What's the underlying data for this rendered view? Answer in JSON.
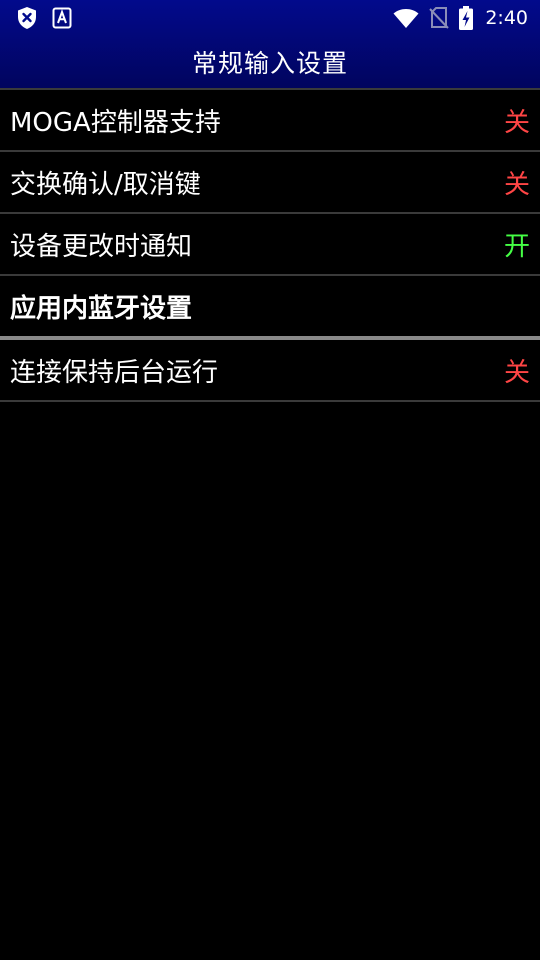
{
  "status_bar": {
    "time": "2:40",
    "left_icons": [
      "shield-x-icon",
      "font-a-icon"
    ],
    "right_icons": [
      "wifi-icon",
      "no-sim-icon",
      "battery-charging-icon"
    ]
  },
  "header": {
    "title": "常规输入设置",
    "background_color": "#020a8c"
  },
  "settings": {
    "items": [
      {
        "label": "MOGA控制器支持",
        "value": "关",
        "state": "off"
      },
      {
        "label": "交换确认/取消键",
        "value": "关",
        "state": "off"
      },
      {
        "label": "设备更改时通知",
        "value": "开",
        "state": "on"
      }
    ],
    "section_title": "应用内蓝牙设置",
    "section_items": [
      {
        "label": "连接保持后台运行",
        "value": "关",
        "state": "off"
      }
    ]
  },
  "colors": {
    "off": "#ff4545",
    "on": "#45ff45",
    "divider": "#3a3a3a"
  }
}
